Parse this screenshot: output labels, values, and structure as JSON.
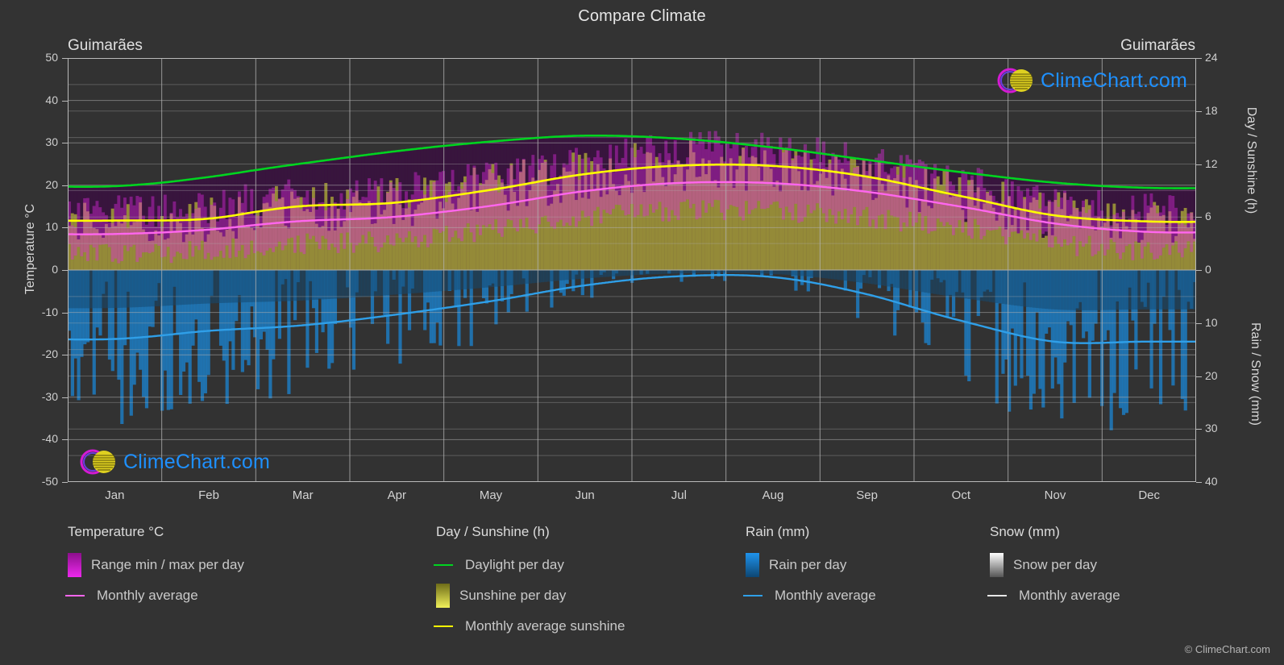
{
  "title": "Compare Climate",
  "locations": {
    "left": "Guimarães",
    "right": "Guimarães"
  },
  "copyright": "© ClimeChart.com",
  "watermark": {
    "text": "ClimeChart.com"
  },
  "colors": {
    "background": "#333333",
    "plot_background": "#323232",
    "grid": "#9a9a9a",
    "text": "#d8d8d8",
    "temperature_range": "#e31ae3",
    "temperature_average": "#ff66ee",
    "daylight": "#00d420",
    "sunshine_band": "#c8c832",
    "sunshine_average": "#ffff00",
    "rain": "#1b86d6",
    "rain_average": "#2f9fe8",
    "snow": "#ffffff",
    "snow_average": "#ffffff",
    "logo_blue": "#1e90ff",
    "logo_magenta": "#d41ad4",
    "logo_sphere": "#e0d020"
  },
  "axes": {
    "left": {
      "title": "Temperature °C",
      "ticks": [
        "50",
        "40",
        "30",
        "20",
        "10",
        "0",
        "-10",
        "-20",
        "-30",
        "-40",
        "-50"
      ],
      "min": -50,
      "max": 50
    },
    "right_top": {
      "title": "Day / Sunshine (h)",
      "ticks": [
        "24",
        "18",
        "12",
        "6",
        "0"
      ],
      "min": 0,
      "max": 24
    },
    "right_bottom": {
      "title": "Rain / Snow (mm)",
      "ticks": [
        "0",
        "10",
        "20",
        "30",
        "40"
      ],
      "min": 0,
      "max": 40
    },
    "x": {
      "ticks": [
        "Jan",
        "Feb",
        "Mar",
        "Apr",
        "May",
        "Jun",
        "Jul",
        "Aug",
        "Sep",
        "Oct",
        "Nov",
        "Dec"
      ]
    }
  },
  "legend": {
    "groups": [
      {
        "heading": "Temperature °C",
        "items": [
          {
            "label": "Range min / max per day",
            "marker": "gradient-swatch",
            "color": "#e31ae3"
          },
          {
            "label": "Monthly average",
            "marker": "line",
            "color": "#ff66ee"
          }
        ]
      },
      {
        "heading": "Day / Sunshine (h)",
        "items": [
          {
            "label": "Daylight per day",
            "marker": "line",
            "color": "#00d420"
          },
          {
            "label": "Sunshine per day",
            "marker": "gradient-swatch",
            "color": "#e8e84a"
          },
          {
            "label": "Monthly average sunshine",
            "marker": "line",
            "color": "#ffff00"
          }
        ]
      },
      {
        "heading": "Rain (mm)",
        "items": [
          {
            "label": "Rain per day",
            "marker": "gradient-swatch",
            "color": "#1b86d6"
          },
          {
            "label": "Monthly average",
            "marker": "line",
            "color": "#2f9fe8"
          }
        ]
      },
      {
        "heading": "Snow (mm)",
        "items": [
          {
            "label": "Snow per day",
            "marker": "gradient-swatch",
            "color": "#ffffff"
          },
          {
            "label": "Monthly average",
            "marker": "line",
            "color": "#ffffff"
          }
        ]
      }
    ]
  },
  "chart_data": {
    "type": "area",
    "title": "Compare Climate",
    "subtitle": "Guimarães",
    "xlabel": "",
    "ylabel": "Temperature °C",
    "grid": true,
    "legend_position": "bottom",
    "categories": [
      "Jan",
      "Feb",
      "Mar",
      "Apr",
      "May",
      "Jun",
      "Jul",
      "Aug",
      "Sep",
      "Oct",
      "Nov",
      "Dec"
    ],
    "axis_ranges": {
      "temperature_c": [
        -50,
        50
      ],
      "day_sunshine_h": [
        0,
        24
      ],
      "rain_snow_mm": [
        0,
        40
      ]
    },
    "series": [
      {
        "name": "Monthly average temperature (°C)",
        "unit": "°C",
        "axis": "left",
        "color": "#ff66ee",
        "values": [
          8.5,
          9.5,
          11.5,
          12.5,
          15.0,
          18.5,
          20.5,
          20.5,
          18.5,
          15.0,
          11.0,
          9.0
        ]
      },
      {
        "name": "Daily maximum temperature (°C)",
        "unit": "°C",
        "axis": "left",
        "color": "#e31ae3",
        "values": [
          13.5,
          15.0,
          17.5,
          18.5,
          21.5,
          25.5,
          28.5,
          28.5,
          25.5,
          21.0,
          16.5,
          14.0
        ]
      },
      {
        "name": "Daily minimum temperature (°C)",
        "unit": "°C",
        "axis": "left",
        "color": "#e31ae3",
        "values": [
          4.0,
          4.5,
          6.0,
          7.0,
          9.5,
          12.5,
          14.0,
          14.0,
          12.5,
          10.0,
          6.5,
          4.5
        ]
      },
      {
        "name": "Daylight per day (h)",
        "unit": "h",
        "axis": "right_top",
        "color": "#00d420",
        "values": [
          9.5,
          10.5,
          12.0,
          13.4,
          14.5,
          15.2,
          14.9,
          13.9,
          12.5,
          11.1,
          9.9,
          9.3
        ]
      },
      {
        "name": "Monthly average sunshine (h)",
        "unit": "h",
        "axis": "right_top",
        "color": "#ffff00",
        "values": [
          5.6,
          5.8,
          7.2,
          7.6,
          9.0,
          10.8,
          11.8,
          11.8,
          10.6,
          8.4,
          6.2,
          5.5
        ]
      },
      {
        "name": "Monthly average rain (mm)",
        "unit": "mm",
        "axis": "right_bottom",
        "color": "#2f9fe8",
        "values": [
          13.0,
          11.5,
          10.5,
          8.5,
          6.0,
          3.0,
          1.2,
          1.3,
          4.5,
          9.5,
          13.5,
          13.5
        ]
      },
      {
        "name": "Monthly average snow (mm)",
        "unit": "mm",
        "axis": "right_bottom",
        "color": "#ffffff",
        "values": [
          0,
          0,
          0,
          0,
          0,
          0,
          0,
          0,
          0,
          0,
          0,
          0
        ]
      }
    ]
  }
}
